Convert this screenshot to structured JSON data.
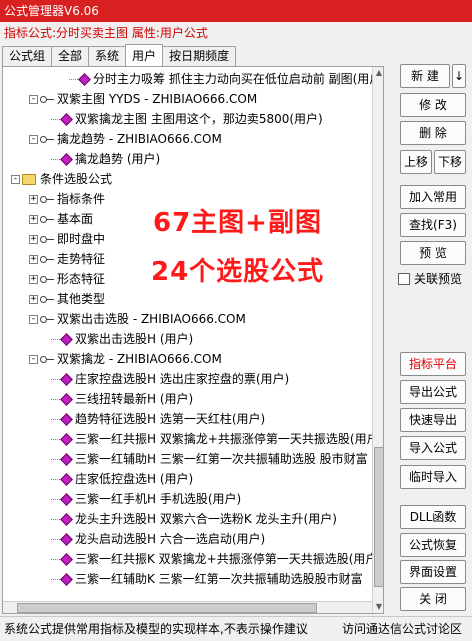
{
  "window": {
    "title": "公式管理器V6.06"
  },
  "formula_bar": {
    "text": "指标公式:分时买卖主图 属性:用户公式"
  },
  "tabs": [
    {
      "label": "公式组"
    },
    {
      "label": "全部"
    },
    {
      "label": "系统"
    },
    {
      "label": "用户"
    },
    {
      "label": "按日期频度"
    }
  ],
  "tree": [
    {
      "type": "gem",
      "label": "分时主力吸筹  抓住主力动向买在低位启动前  副图(用户)"
    },
    {
      "type": "key",
      "expander": "-",
      "label": "双紫主图 YYDS - ZHIBIAO666.COM"
    },
    {
      "type": "gem",
      "label": "双紫擒龙主图 主图用这个，那边卖5800(用户)"
    },
    {
      "type": "key",
      "expander": "-",
      "label": "擒龙趋势 - ZHIBIAO666.COM"
    },
    {
      "type": "gem",
      "label": "擒龙趋势 (用户)"
    },
    {
      "type": "folder",
      "expander": "-",
      "label": "条件选股公式"
    },
    {
      "type": "key",
      "expander": "+",
      "label": "指标条件"
    },
    {
      "type": "key",
      "expander": "+",
      "label": "基本面"
    },
    {
      "type": "key",
      "expander": "+",
      "label": "即时盘中"
    },
    {
      "type": "key",
      "expander": "+",
      "label": "走势特征"
    },
    {
      "type": "key",
      "expander": "+",
      "label": "形态特征"
    },
    {
      "type": "key",
      "expander": "+",
      "label": "其他类型"
    },
    {
      "type": "key",
      "expander": "-",
      "label": "双紫出击选股 - ZHIBIAO666.COM"
    },
    {
      "type": "gem",
      "label": "双紫出击选股H (用户)"
    },
    {
      "type": "key",
      "expander": "-",
      "label": "双紫擒龙 - ZHIBIAO666.COM"
    },
    {
      "type": "gem",
      "label": "庄家控盘选股H 选出庄家控盘的票(用户)"
    },
    {
      "type": "gem",
      "label": "三线扭转最新H (用户)"
    },
    {
      "type": "gem",
      "label": "趋势特征选股H 选第一天红柱(用户)"
    },
    {
      "type": "gem",
      "label": "三紫一红共振H 双紫擒龙+共振涨停第一天共振选股(用户)"
    },
    {
      "type": "gem",
      "label": "三紫一红辅助H 三紫一红第一次共振辅助选股 股市财富"
    },
    {
      "type": "gem",
      "label": "庄家低控盘选H (用户)"
    },
    {
      "type": "gem",
      "label": "三紫一红手机H 手机选股(用户)"
    },
    {
      "type": "gem",
      "label": "龙头主升选股H 双紫六合一选粉K 龙头主升(用户)"
    },
    {
      "type": "gem",
      "label": "龙头启动选股H 六合一选启动(用户)"
    },
    {
      "type": "gem",
      "label": "三紫一红共振K 双紫擒龙+共振涨停第一天共振选股(用户)"
    },
    {
      "type": "gem",
      "label": "三紫一红辅助K 三紫一红第一次共振辅助选股股市财富"
    }
  ],
  "overlay": {
    "line1": "67主图+副图",
    "line2": "24个选股公式"
  },
  "buttons": {
    "new": "新 建",
    "new_arrow": "↓",
    "modify": "修 改",
    "delete": "删 除",
    "move_up": "上移",
    "move_down": "下移",
    "add_common": "加入常用",
    "find": "查找(F3)",
    "preview": "预 览",
    "linked_preview": "关联预览",
    "indicator_platform": "指标平台",
    "export_formula": "导出公式",
    "quick_export": "快速导出",
    "import_formula": "导入公式",
    "temp_import": "临时导入",
    "dll": "DLL函数",
    "restore": "公式恢复",
    "ui_settings": "界面设置",
    "close": "关 闭"
  },
  "statusbar": {
    "left": "系统公式提供常用指标及模型的实现样本,不表示操作建议",
    "right": "访问通达信公式讨论区"
  }
}
